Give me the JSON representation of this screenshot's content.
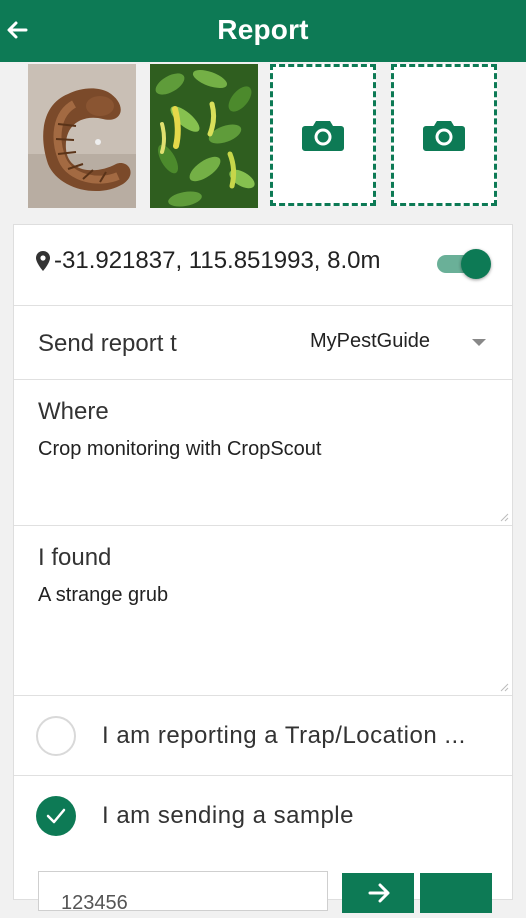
{
  "header": {
    "title": "Report",
    "back_icon": "arrow-left-icon"
  },
  "photos": {
    "items": [
      {
        "name": "grub-photo",
        "kind": "photo"
      },
      {
        "name": "plants-photo",
        "kind": "photo"
      }
    ],
    "empty_slot_icon": "camera-icon",
    "empty_slot_count": 2
  },
  "location": {
    "coords": "-31.921837, 115.851993, 8.0m",
    "icon": "map-pin-icon",
    "enabled": true
  },
  "send_to": {
    "label": "Send report t",
    "selected": "MyPestGuide"
  },
  "where": {
    "label": "Where",
    "value": "Crop monitoring with CropScout"
  },
  "found": {
    "label": "I found",
    "value": "A strange grub"
  },
  "options": {
    "trap": {
      "label": "I am reporting a Trap/Location ...",
      "checked": false
    },
    "sample": {
      "label": "I am sending a sample",
      "checked": true
    }
  },
  "sample_id": {
    "value": "123456"
  },
  "colors": {
    "primary": "#0d7a55",
    "toggle_track": "#6ab098",
    "background": "#f1f1f1"
  }
}
